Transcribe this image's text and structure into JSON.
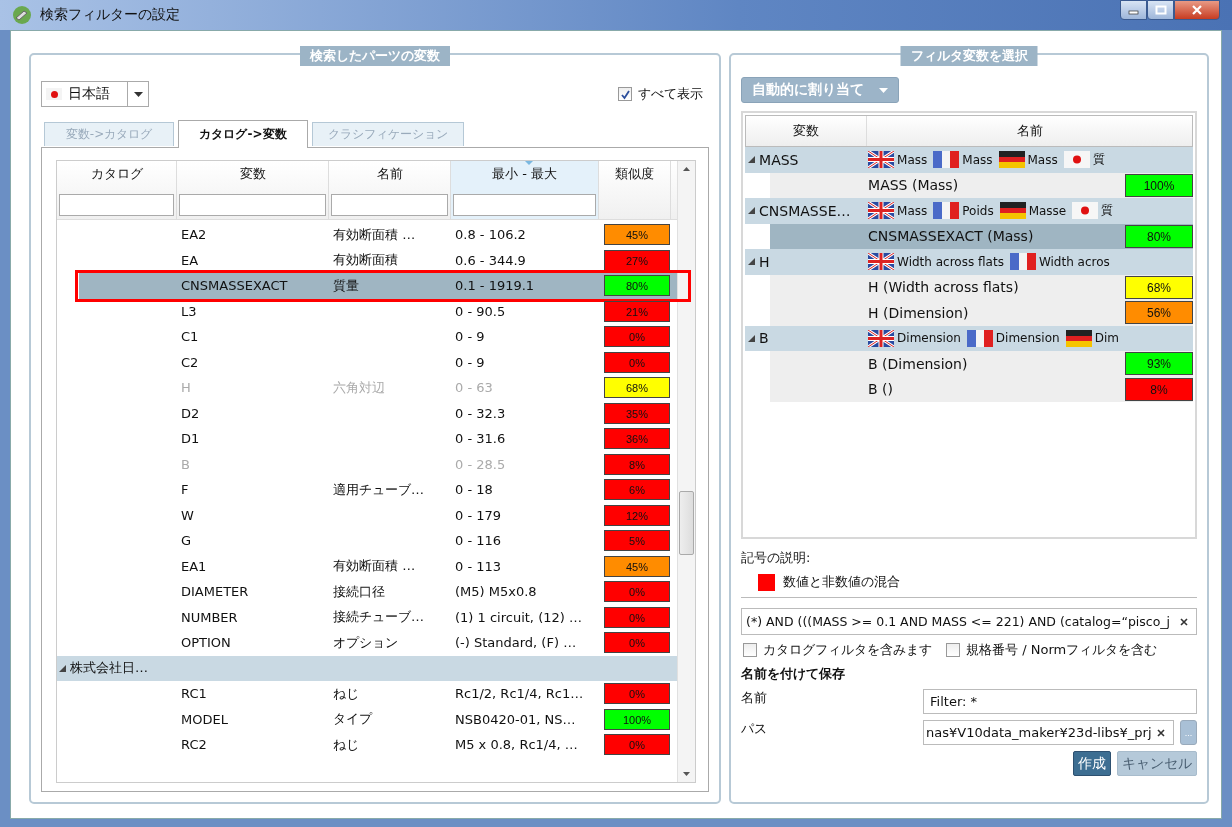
{
  "window": {
    "title": "検索フィルターの設定"
  },
  "left_panel": {
    "title": "検索したパーツの変数",
    "language": {
      "label": "日本語"
    },
    "show_all": {
      "label": "すべて表示",
      "checked": true
    },
    "tabs": [
      {
        "label": "変数->カタログ",
        "selected": false
      },
      {
        "label": "カタログ->変数",
        "selected": true
      },
      {
        "label": "クラシフィケーション",
        "selected": false
      }
    ],
    "table": {
      "columns": [
        {
          "label": "カタログ",
          "sorted": false,
          "filter": true
        },
        {
          "label": "変数",
          "sorted": false,
          "filter": true
        },
        {
          "label": "名前",
          "sorted": false,
          "filter": true
        },
        {
          "label": "最小 - 最大",
          "sorted": true,
          "filter": true
        },
        {
          "label": "類似度",
          "sorted": false,
          "filter": false
        }
      ],
      "rows": [
        {
          "kind": "item",
          "variable": "EA2",
          "name": "有効断面積 …",
          "range": "0.8 - 106.2",
          "similarity": "45%",
          "color": "#ff8c00",
          "dimmed": false,
          "selected": false
        },
        {
          "kind": "item",
          "variable": "EA",
          "name": "有効断面積",
          "range": "0.6 - 344.9",
          "similarity": "27%",
          "color": "#ff0000",
          "dimmed": false,
          "selected": false
        },
        {
          "kind": "item",
          "variable": "CNSMASSEXACT",
          "name": "質量",
          "range": "0.1 - 1919.1",
          "similarity": "80%",
          "color": "#00ff00",
          "dimmed": false,
          "selected": true
        },
        {
          "kind": "item",
          "variable": "L3",
          "name": "",
          "range": "0 - 90.5",
          "similarity": "21%",
          "color": "#ff0000",
          "dimmed": false,
          "selected": false
        },
        {
          "kind": "item",
          "variable": "C1",
          "name": "",
          "range": "0 - 9",
          "similarity": "0%",
          "color": "#ff0000",
          "dimmed": false,
          "selected": false
        },
        {
          "kind": "item",
          "variable": "C2",
          "name": "",
          "range": "0 - 9",
          "similarity": "0%",
          "color": "#ff0000",
          "dimmed": false,
          "selected": false
        },
        {
          "kind": "item",
          "variable": "H",
          "name": "六角対辺",
          "range": "0 - 63",
          "similarity": "68%",
          "color": "#ffff00",
          "dimmed": true,
          "selected": false
        },
        {
          "kind": "item",
          "variable": "D2",
          "name": "",
          "range": "0 - 32.3",
          "similarity": "35%",
          "color": "#ff0000",
          "dimmed": false,
          "selected": false
        },
        {
          "kind": "item",
          "variable": "D1",
          "name": "",
          "range": "0 - 31.6",
          "similarity": "36%",
          "color": "#ff0000",
          "dimmed": false,
          "selected": false
        },
        {
          "kind": "item",
          "variable": "B",
          "name": "",
          "range": "0 - 28.5",
          "similarity": "8%",
          "color": "#ff0000",
          "dimmed": true,
          "selected": false
        },
        {
          "kind": "item",
          "variable": "F",
          "name": "適用チューブ…",
          "range": "0 - 18",
          "similarity": "6%",
          "color": "#ff0000",
          "dimmed": false,
          "selected": false
        },
        {
          "kind": "item",
          "variable": "W",
          "name": "",
          "range": "0 - 179",
          "similarity": "12%",
          "color": "#ff0000",
          "dimmed": false,
          "selected": false
        },
        {
          "kind": "item",
          "variable": "G",
          "name": "",
          "range": "0 - 116",
          "similarity": "5%",
          "color": "#ff0000",
          "dimmed": false,
          "selected": false
        },
        {
          "kind": "item",
          "variable": "EA1",
          "name": "有効断面積 …",
          "range": "0 - 113",
          "similarity": "45%",
          "color": "#ff8c00",
          "dimmed": false,
          "selected": false
        },
        {
          "kind": "item",
          "variable": "DIAMETER",
          "name": "接続口径",
          "range": "(M5) M5x0.8",
          "similarity": "0%",
          "color": "#ff0000",
          "dimmed": false,
          "selected": false
        },
        {
          "kind": "item",
          "variable": "NUMBER",
          "name": "接続チューブ…",
          "range": "(1) 1 circuit, (12) …",
          "similarity": "0%",
          "color": "#ff0000",
          "dimmed": false,
          "selected": false
        },
        {
          "kind": "item",
          "variable": "OPTION",
          "name": "オプション",
          "range": "(-) Standard, (F) …",
          "similarity": "0%",
          "color": "#ff0000",
          "dimmed": false,
          "selected": false
        },
        {
          "kind": "group",
          "catalog": "株式会社日…",
          "expanded": true
        },
        {
          "kind": "item",
          "variable": "RC1",
          "name": "ねじ",
          "range": "Rc1/2, Rc1/4, Rc1…",
          "similarity": "0%",
          "color": "#ff0000",
          "dimmed": false,
          "selected": false
        },
        {
          "kind": "item",
          "variable": "MODEL",
          "name": "タイプ",
          "range": "NSB0420-01, NS…",
          "similarity": "100%",
          "color": "#00ff00",
          "dimmed": false,
          "selected": false
        },
        {
          "kind": "item",
          "variable": "RC2",
          "name": "ねじ",
          "range": "M5 x 0.8, Rc1/4, …",
          "similarity": "0%",
          "color": "#ff0000",
          "dimmed": false,
          "selected": false
        }
      ]
    }
  },
  "right_panel": {
    "title": "フィルタ変数を選択",
    "assign_button": "自動的に割り当て",
    "tree": {
      "columns": [
        "変数",
        "名前"
      ],
      "groups": [
        {
          "variable": "MASS",
          "expanded": true,
          "translations": [
            {
              "kind": "uk",
              "text": "Mass"
            },
            {
              "kind": "fr",
              "text": "Mass"
            },
            {
              "kind": "de",
              "text": "Mass"
            },
            {
              "kind": "jp",
              "text": "質"
            }
          ],
          "children": [
            {
              "label": "MASS (Mass)",
              "similarity": "100%",
              "color": "#00ff00",
              "selected": false
            }
          ]
        },
        {
          "variable": "CNSMASSE…",
          "expanded": true,
          "translations": [
            {
              "kind": "uk",
              "text": "Mass"
            },
            {
              "kind": "fr",
              "text": "Poids"
            },
            {
              "kind": "de",
              "text": "Masse"
            },
            {
              "kind": "jp",
              "text": "質"
            }
          ],
          "children": [
            {
              "label": "CNSMASSEXACT (Mass)",
              "similarity": "80%",
              "color": "#00ff00",
              "selected": true
            }
          ]
        },
        {
          "variable": "H",
          "expanded": true,
          "translations": [
            {
              "kind": "uk",
              "text": "Width across flats"
            },
            {
              "kind": "fr",
              "text": "Width acros"
            }
          ],
          "children": [
            {
              "label": "H (Width across flats)",
              "similarity": "68%",
              "color": "#ffff00",
              "selected": false
            },
            {
              "label": "H (Dimension)",
              "similarity": "56%",
              "color": "#ff8c00",
              "selected": false
            }
          ]
        },
        {
          "variable": "B",
          "expanded": true,
          "translations": [
            {
              "kind": "uk",
              "text": "Dimension"
            },
            {
              "kind": "fr",
              "text": "Dimension"
            },
            {
              "kind": "de",
              "text": "Dim"
            }
          ],
          "children": [
            {
              "label": "B (Dimension)",
              "similarity": "93%",
              "color": "#00ff00",
              "selected": false
            },
            {
              "label": "B ()",
              "similarity": "8%",
              "color": "#ff0000",
              "selected": false
            }
          ]
        }
      ]
    },
    "legend": {
      "title": "記号の説明:",
      "items": [
        {
          "label": "数値と非数値の混合",
          "color": "#ff0000"
        }
      ]
    },
    "filter_expression": "(*) AND (((MASS >= 0.1 AND MASS <= 221) AND (catalog=“pisco_j",
    "options": [
      {
        "label": "カタログフィルタを含みます",
        "checked": false
      },
      {
        "label": "規格番号 / Normフィルタを含む",
        "checked": false
      }
    ],
    "save": {
      "title": "名前を付けて保存",
      "name_label": "名前",
      "name_value": "Filter: *",
      "path_label": "パス",
      "path_value": "nas¥V10data_maker¥23d-libs¥_prj",
      "browse": "...",
      "buttons": [
        {
          "label": "作成",
          "disabled": false
        },
        {
          "label": "キャンセル",
          "disabled": true
        }
      ]
    }
  }
}
